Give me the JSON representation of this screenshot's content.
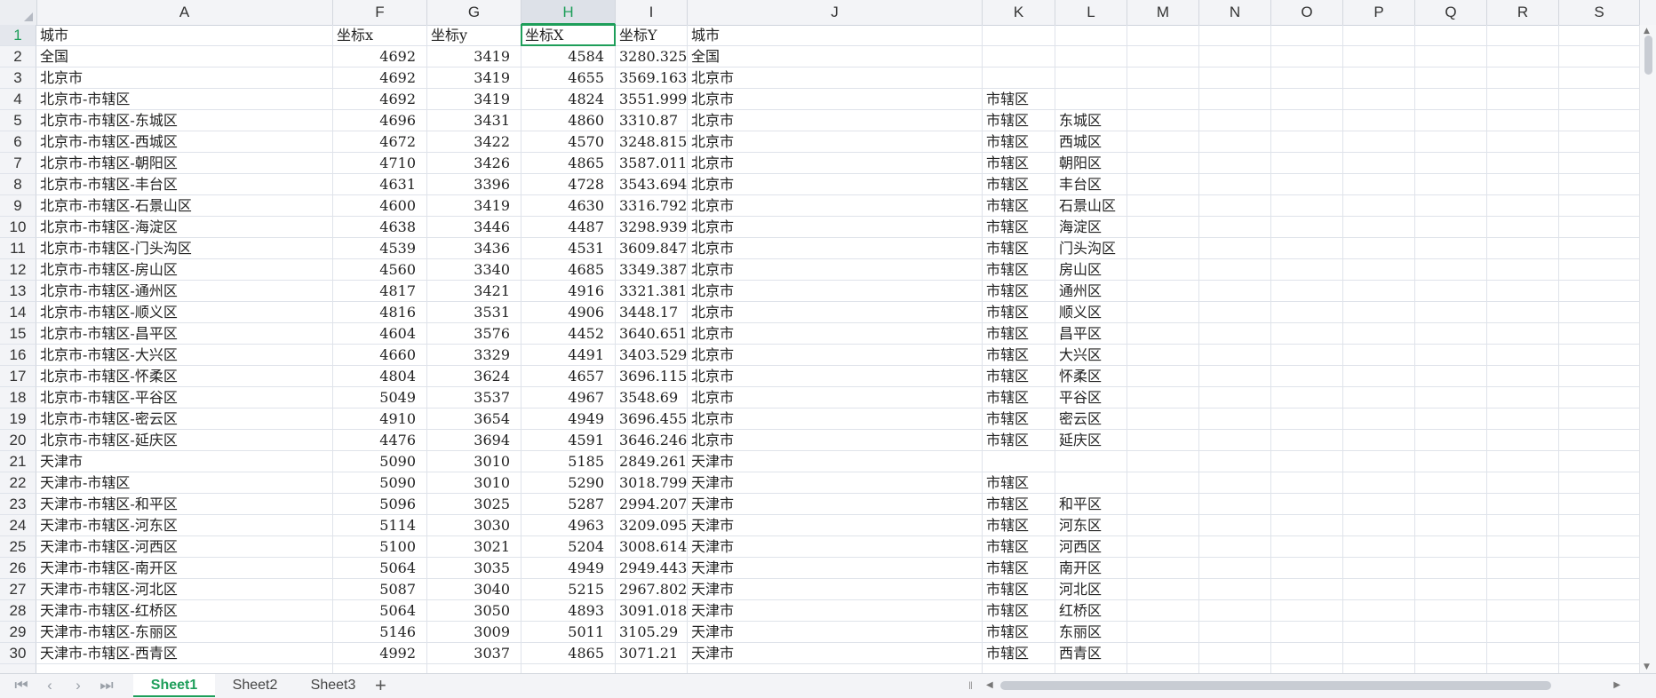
{
  "spreadsheet": {
    "columns": [
      "A",
      "F",
      "G",
      "H",
      "I",
      "J",
      "K",
      "L",
      "M",
      "N",
      "O",
      "P",
      "Q",
      "R",
      "S"
    ],
    "selected_column": "H",
    "selected_row": "1",
    "rows": [
      {
        "n": "1",
        "A": "城市",
        "F": "坐标x",
        "G": "坐标y",
        "H": "坐标X",
        "I": "坐标Y",
        "J": "城市",
        "K": "",
        "L": ""
      },
      {
        "n": "2",
        "A": "全国",
        "F": "4692",
        "G": "3419",
        "H": "4584",
        "I": "3280.325",
        "J": "全国",
        "K": "",
        "L": ""
      },
      {
        "n": "3",
        "A": "北京市",
        "F": "4692",
        "G": "3419",
        "H": "4655",
        "I": "3569.163",
        "J": "北京市",
        "K": "",
        "L": ""
      },
      {
        "n": "4",
        "A": "北京市-市辖区",
        "F": "4692",
        "G": "3419",
        "H": "4824",
        "I": "3551.999",
        "J": "北京市",
        "K": "市辖区",
        "L": ""
      },
      {
        "n": "5",
        "A": "北京市-市辖区-东城区",
        "F": "4696",
        "G": "3431",
        "H": "4860",
        "I": "3310.87",
        "J": "北京市",
        "K": "市辖区",
        "L": "东城区"
      },
      {
        "n": "6",
        "A": "北京市-市辖区-西城区",
        "F": "4672",
        "G": "3422",
        "H": "4570",
        "I": "3248.815",
        "J": "北京市",
        "K": "市辖区",
        "L": "西城区"
      },
      {
        "n": "7",
        "A": "北京市-市辖区-朝阳区",
        "F": "4710",
        "G": "3426",
        "H": "4865",
        "I": "3587.011",
        "J": "北京市",
        "K": "市辖区",
        "L": "朝阳区"
      },
      {
        "n": "8",
        "A": "北京市-市辖区-丰台区",
        "F": "4631",
        "G": "3396",
        "H": "4728",
        "I": "3543.694",
        "J": "北京市",
        "K": "市辖区",
        "L": "丰台区"
      },
      {
        "n": "9",
        "A": "北京市-市辖区-石景山区",
        "F": "4600",
        "G": "3419",
        "H": "4630",
        "I": "3316.792",
        "J": "北京市",
        "K": "市辖区",
        "L": "石景山区"
      },
      {
        "n": "10",
        "A": "北京市-市辖区-海淀区",
        "F": "4638",
        "G": "3446",
        "H": "4487",
        "I": "3298.939",
        "J": "北京市",
        "K": "市辖区",
        "L": "海淀区"
      },
      {
        "n": "11",
        "A": "北京市-市辖区-门头沟区",
        "F": "4539",
        "G": "3436",
        "H": "4531",
        "I": "3609.847",
        "J": "北京市",
        "K": "市辖区",
        "L": "门头沟区"
      },
      {
        "n": "12",
        "A": "北京市-市辖区-房山区",
        "F": "4560",
        "G": "3340",
        "H": "4685",
        "I": "3349.387",
        "J": "北京市",
        "K": "市辖区",
        "L": "房山区"
      },
      {
        "n": "13",
        "A": "北京市-市辖区-通州区",
        "F": "4817",
        "G": "3421",
        "H": "4916",
        "I": "3321.381",
        "J": "北京市",
        "K": "市辖区",
        "L": "通州区"
      },
      {
        "n": "14",
        "A": "北京市-市辖区-顺义区",
        "F": "4816",
        "G": "3531",
        "H": "4906",
        "I": "3448.17",
        "J": "北京市",
        "K": "市辖区",
        "L": "顺义区"
      },
      {
        "n": "15",
        "A": "北京市-市辖区-昌平区",
        "F": "4604",
        "G": "3576",
        "H": "4452",
        "I": "3640.651",
        "J": "北京市",
        "K": "市辖区",
        "L": "昌平区"
      },
      {
        "n": "16",
        "A": "北京市-市辖区-大兴区",
        "F": "4660",
        "G": "3329",
        "H": "4491",
        "I": "3403.529",
        "J": "北京市",
        "K": "市辖区",
        "L": "大兴区"
      },
      {
        "n": "17",
        "A": "北京市-市辖区-怀柔区",
        "F": "4804",
        "G": "3624",
        "H": "4657",
        "I": "3696.115",
        "J": "北京市",
        "K": "市辖区",
        "L": "怀柔区"
      },
      {
        "n": "18",
        "A": "北京市-市辖区-平谷区",
        "F": "5049",
        "G": "3537",
        "H": "4967",
        "I": "3548.69",
        "J": "北京市",
        "K": "市辖区",
        "L": "平谷区"
      },
      {
        "n": "19",
        "A": "北京市-市辖区-密云区",
        "F": "4910",
        "G": "3654",
        "H": "4949",
        "I": "3696.455",
        "J": "北京市",
        "K": "市辖区",
        "L": "密云区"
      },
      {
        "n": "20",
        "A": "北京市-市辖区-延庆区",
        "F": "4476",
        "G": "3694",
        "H": "4591",
        "I": "3646.246",
        "J": "北京市",
        "K": "市辖区",
        "L": "延庆区"
      },
      {
        "n": "21",
        "A": "天津市",
        "F": "5090",
        "G": "3010",
        "H": "5185",
        "I": "2849.261",
        "J": "天津市",
        "K": "",
        "L": ""
      },
      {
        "n": "22",
        "A": "天津市-市辖区",
        "F": "5090",
        "G": "3010",
        "H": "5290",
        "I": "3018.799",
        "J": "天津市",
        "K": "市辖区",
        "L": ""
      },
      {
        "n": "23",
        "A": "天津市-市辖区-和平区",
        "F": "5096",
        "G": "3025",
        "H": "5287",
        "I": "2994.207",
        "J": "天津市",
        "K": "市辖区",
        "L": "和平区"
      },
      {
        "n": "24",
        "A": "天津市-市辖区-河东区",
        "F": "5114",
        "G": "3030",
        "H": "4963",
        "I": "3209.095",
        "J": "天津市",
        "K": "市辖区",
        "L": "河东区"
      },
      {
        "n": "25",
        "A": "天津市-市辖区-河西区",
        "F": "5100",
        "G": "3021",
        "H": "5204",
        "I": "3008.614",
        "J": "天津市",
        "K": "市辖区",
        "L": "河西区"
      },
      {
        "n": "26",
        "A": "天津市-市辖区-南开区",
        "F": "5064",
        "G": "3035",
        "H": "4949",
        "I": "2949.443",
        "J": "天津市",
        "K": "市辖区",
        "L": "南开区"
      },
      {
        "n": "27",
        "A": "天津市-市辖区-河北区",
        "F": "5087",
        "G": "3040",
        "H": "5215",
        "I": "2967.802",
        "J": "天津市",
        "K": "市辖区",
        "L": "河北区"
      },
      {
        "n": "28",
        "A": "天津市-市辖区-红桥区",
        "F": "5064",
        "G": "3050",
        "H": "4893",
        "I": "3091.018",
        "J": "天津市",
        "K": "市辖区",
        "L": "红桥区"
      },
      {
        "n": "29",
        "A": "天津市-市辖区-东丽区",
        "F": "5146",
        "G": "3009",
        "H": "5011",
        "I": "3105.29",
        "J": "天津市",
        "K": "市辖区",
        "L": "东丽区"
      },
      {
        "n": "30",
        "A": "天津市-市辖区-西青区",
        "F": "4992",
        "G": "3037",
        "H": "4865",
        "I": "3071.21",
        "J": "天津市",
        "K": "市辖区",
        "L": "西青区"
      }
    ]
  },
  "sheet_tabs": {
    "tabs": [
      "Sheet1",
      "Sheet2",
      "Sheet3"
    ],
    "active": "Sheet1",
    "add_label": "+"
  },
  "nav": {
    "first": "⏮",
    "prev": "‹",
    "next": "›",
    "last": "⏭"
  },
  "colors": {
    "accent": "#1e9e5a",
    "grid": "#dfe3ea",
    "header_bg": "#f3f4f7"
  }
}
